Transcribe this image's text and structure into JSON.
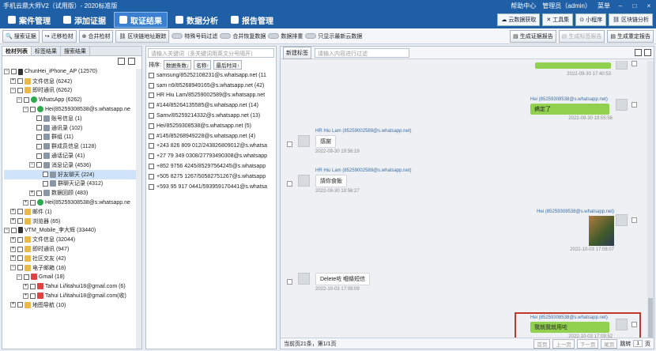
{
  "window": {
    "title": "手机云鼎大师V2（试用版）- 2020标准版",
    "help": "帮助中心",
    "user": "管理员（admin）",
    "menu_label": "菜单"
  },
  "menu": {
    "items": [
      "案件管理",
      "添加证据",
      "取证结果",
      "数据分析",
      "报告管理"
    ],
    "active_index": 2,
    "right_buttons": [
      "云数据获取",
      "工具集",
      "小程序",
      "区块链分析"
    ]
  },
  "toolbar": {
    "buttons": [
      "搜索证据",
      "迁移检材",
      "合并检材",
      "区块链地址跟踪"
    ],
    "toggles": [
      "特殊号码过滤",
      "合并恢复数据",
      "数据排重",
      "只显示最新云数据"
    ],
    "right_buttons": [
      "生成证据报告",
      "生成标签报告",
      "生成重定报告"
    ]
  },
  "left_panel": {
    "tabs": [
      "检材列表",
      "标签结果",
      "搜索结果"
    ],
    "tree": [
      {
        "indent": 0,
        "label": "ChunHei_iPhone_AP (12570)",
        "icon": "phone",
        "exp": "−"
      },
      {
        "indent": 1,
        "label": "文件信息 (6242)",
        "icon": "folder",
        "exp": "+"
      },
      {
        "indent": 1,
        "label": "即时通讯 (6262)",
        "icon": "folder",
        "exp": "−"
      },
      {
        "indent": 2,
        "label": "WhatsApp (6262)",
        "icon": "green",
        "exp": "−"
      },
      {
        "indent": 3,
        "label": "Hei(85259308538@s.whatsapp.ne",
        "icon": "green",
        "exp": "−"
      },
      {
        "indent": 4,
        "label": "账号信息 (1)",
        "icon": "gray",
        "exp": ""
      },
      {
        "indent": 4,
        "label": "通讯录 (102)",
        "icon": "gray",
        "exp": ""
      },
      {
        "indent": 4,
        "label": "群组 (11)",
        "icon": "gray",
        "exp": ""
      },
      {
        "indent": 4,
        "label": "群成员信息 (1128)",
        "icon": "gray",
        "exp": ""
      },
      {
        "indent": 4,
        "label": "通话记录 (41)",
        "icon": "gray",
        "exp": ""
      },
      {
        "indent": 4,
        "label": "消息记录 (4536)",
        "icon": "gray",
        "exp": "−"
      },
      {
        "indent": 5,
        "label": "好友聊天 (224)",
        "icon": "gray",
        "exp": "",
        "selected": true
      },
      {
        "indent": 5,
        "label": "群聊天记录 (4312)",
        "icon": "gray",
        "exp": ""
      },
      {
        "indent": 4,
        "label": "数据回顾 (483)",
        "icon": "gray",
        "exp": "+"
      },
      {
        "indent": 3,
        "label": "Hei(85259308538@s.whatsapp.ne",
        "icon": "green",
        "exp": "+"
      },
      {
        "indent": 1,
        "label": "邮件 (1)",
        "icon": "folder",
        "exp": "+"
      },
      {
        "indent": 1,
        "label": "浏览器 (65)",
        "icon": "folder",
        "exp": "+"
      },
      {
        "indent": 0,
        "label": "VTM_Mobile_李大辉 (33440)",
        "icon": "phone",
        "exp": "−"
      },
      {
        "indent": 1,
        "label": "文件信息 (32044)",
        "icon": "folder",
        "exp": "+"
      },
      {
        "indent": 1,
        "label": "即时通讯 (947)",
        "icon": "folder",
        "exp": "+"
      },
      {
        "indent": 1,
        "label": "社区交友 (42)",
        "icon": "folder",
        "exp": "+"
      },
      {
        "indent": 1,
        "label": "电子邮箱 (18)",
        "icon": "folder",
        "exp": "−"
      },
      {
        "indent": 2,
        "label": "Gmail (18)",
        "icon": "mail",
        "exp": "−"
      },
      {
        "indent": 3,
        "label": "Tahui Li/litahui18@gmail.com (6)",
        "icon": "mail",
        "exp": "+"
      },
      {
        "indent": 3,
        "label": "Tahui Li/litahui18@gmail.com(收)",
        "icon": "mail",
        "exp": "+"
      },
      {
        "indent": 1,
        "label": "地图导航 (10)",
        "icon": "folder",
        "exp": "+"
      }
    ]
  },
  "mid_panel": {
    "search_placeholder": "请输入关键词（多关键词用英文分号隔开）",
    "sort_label": "排序:",
    "sort_buttons": [
      "数据条数↓",
      "名称↑",
      "最后时间↑"
    ],
    "contacts": [
      "samsung/85252108231@s.whatsapp.net (11",
      "sam n9/85268949165@s.whatsapp.net (42)",
      "HR Hiu Lam/85259002589@s.whatsapp.net",
      "#144/85264135585@s.whatsapp.net (14)",
      "Samv/85259214332@s.whatsapp.net (13)",
      "Hei/85259308538@s.whatsapp.net (5)",
      "#145/85268949228@s.whatsapp.net (4)",
      "+243 826 809 012/243826809012@s.whatsa",
      "+27 79 349 0308/27793490308@s.whatsapp",
      "+852 9756 4245/85297564245@s.whatsapp",
      "+505 8275 1267/50582751267@s.whatsapp",
      "+593 95 917 0441/593959170441@s.whatsa"
    ]
  },
  "right_panel": {
    "new_tag_button": "新建标签",
    "search_placeholder": "请输入内容进行过滤",
    "messages": [
      {
        "dir": "out",
        "sender": "",
        "text": "",
        "time": "2022-09-30 17:40:53"
      },
      {
        "dir": "out",
        "sender": "Hei (85259308538@s.whatsapp.net)",
        "text": "搞定了",
        "time": "2022-09-30 19:55:56"
      },
      {
        "dir": "in",
        "sender": "HR Hiu Lam (85259002589@s.whatsapp.net)",
        "text": "感謝",
        "time": "2022-09-30 19:56:19"
      },
      {
        "dir": "in",
        "sender": "HR Hiu Lam (85259002589@s.whatsapp.net)",
        "text": "請你食飯",
        "time": "2022-09-30 19:56:27"
      },
      {
        "dir": "out",
        "sender": "Hei (85259308538@s.whatsapp.net)",
        "text": "",
        "time": "2022-10-03 17:08:07"
      },
      {
        "dir": "in",
        "sender": "",
        "text": "Delete咗 嗰條短信",
        "time": "2022-10-03 17:09:09"
      },
      {
        "dir": "out",
        "sender": "Hei (85259308538@s.whatsapp.net)",
        "text": "我就我就用咗",
        "time": "2022-10-03 17:09:52"
      }
    ]
  },
  "footer": {
    "summary": "当前页21条，第1/1页",
    "buttons": [
      "首页",
      "上一页",
      "下一页",
      "尾页"
    ],
    "goto_label": "跳转",
    "page_value": "1",
    "page_unit": "页"
  }
}
